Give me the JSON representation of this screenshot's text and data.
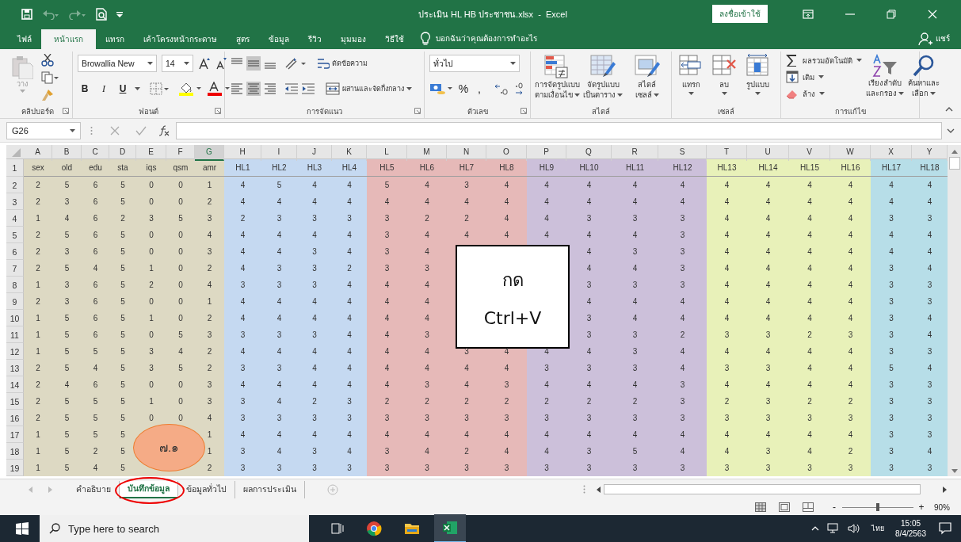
{
  "title_bar": {
    "title": "ประเมิน HL HB ประชาชน.xlsx  -  Excel",
    "sign_in": "ลงชื่อเข้าใช้"
  },
  "ribbon_tabs": [
    {
      "label": "ไฟล์",
      "selected": false
    },
    {
      "label": "หน้าแรก",
      "selected": true
    },
    {
      "label": "แทรก",
      "selected": false
    },
    {
      "label": "เค้าโครงหน้ากระดาษ",
      "selected": false
    },
    {
      "label": "สูตร",
      "selected": false
    },
    {
      "label": "ข้อมูล",
      "selected": false
    },
    {
      "label": "รีวิว",
      "selected": false
    },
    {
      "label": "มุมมอง",
      "selected": false
    },
    {
      "label": "วิธีใช้",
      "selected": false
    }
  ],
  "tell_me": "บอกฉันว่าคุณต้องการทำอะไร",
  "share": "แชร์",
  "ribbon": {
    "clipboard": {
      "paste": "วาง",
      "label": "คลิปบอร์ด"
    },
    "font": {
      "name": "Browallia New",
      "size": "14",
      "bold": "B",
      "italic": "I",
      "underline": "U",
      "label": "ฟอนต์"
    },
    "alignment": {
      "vertical": [
        {
          "selected": false
        },
        {
          "selected": true
        },
        {
          "selected": false
        }
      ],
      "horizontal": [
        {
          "selected": false
        },
        {
          "selected": true
        },
        {
          "selected": false
        }
      ],
      "wrap": "ตัดข้อความ",
      "merge": "ผสานและจัดกึ่งกลาง",
      "label": "การจัดแนว"
    },
    "number": {
      "format": "ทั่วไป",
      "percent": "%",
      "comma": ",",
      "label": "ตัวเลข"
    },
    "styles": {
      "buttons": [
        {
          "lines": [
            "การจัดรูปแบบ",
            "ตามเงื่อนไข"
          ]
        },
        {
          "lines": [
            "จัดรูปแบบ",
            "เป็นตาราง"
          ]
        },
        {
          "lines": [
            "สไตล์",
            "เซลล์"
          ]
        }
      ],
      "label": "สไตล์"
    },
    "cells": {
      "buttons": [
        "แทรก",
        "ลบ",
        "รูปแบบ"
      ],
      "label": "เซลล์"
    },
    "editing": {
      "small": [
        "ผลรวมอัตโนมัติ",
        "เติม",
        "ล้าง"
      ],
      "large": [
        {
          "lines": [
            "เรียงลำดับ",
            "และกรอง"
          ]
        },
        {
          "lines": [
            "ค้นหาและ",
            "เลือก"
          ]
        }
      ],
      "label": "การแก้ไข"
    }
  },
  "name_box": "G26",
  "grid": {
    "columns": [
      {
        "letter": "A",
        "selected": false,
        "color": "#ddd9c3"
      },
      {
        "letter": "B",
        "selected": false,
        "color": "#ddd9c3"
      },
      {
        "letter": "C",
        "selected": false,
        "color": "#ddd9c3"
      },
      {
        "letter": "D",
        "selected": false,
        "color": "#ddd9c3"
      },
      {
        "letter": "E",
        "selected": false,
        "color": "#ddd9c3"
      },
      {
        "letter": "F",
        "selected": false,
        "color": "#ddd9c3"
      },
      {
        "letter": "G",
        "selected": true,
        "color": "#ddd9c3"
      },
      {
        "letter": "H",
        "selected": false,
        "color": "#c5d9f1"
      },
      {
        "letter": "I",
        "selected": false,
        "color": "#c5d9f1"
      },
      {
        "letter": "J",
        "selected": false,
        "color": "#c5d9f1"
      },
      {
        "letter": "K",
        "selected": false,
        "color": "#c5d9f1"
      },
      {
        "letter": "L",
        "selected": false,
        "color": "#e6b9b8"
      },
      {
        "letter": "M",
        "selected": false,
        "color": "#e6b9b8"
      },
      {
        "letter": "N",
        "selected": false,
        "color": "#e6b9b8"
      },
      {
        "letter": "O",
        "selected": false,
        "color": "#e6b9b8"
      },
      {
        "letter": "P",
        "selected": false,
        "color": "#ccc0da"
      },
      {
        "letter": "Q",
        "selected": false,
        "color": "#ccc0da"
      },
      {
        "letter": "R",
        "selected": false,
        "color": "#ccc0da"
      },
      {
        "letter": "S",
        "selected": false,
        "color": "#ccc0da"
      },
      {
        "letter": "T",
        "selected": false,
        "color": "#e8f1b9"
      },
      {
        "letter": "U",
        "selected": false,
        "color": "#e8f1b9"
      },
      {
        "letter": "V",
        "selected": false,
        "color": "#e8f1b9"
      },
      {
        "letter": "W",
        "selected": false,
        "color": "#e8f1b9"
      },
      {
        "letter": "X",
        "selected": false,
        "color": "#b7dee8"
      },
      {
        "letter": "Y",
        "selected": false,
        "color": "#b7dee8"
      }
    ],
    "rows": [
      {
        "number": "1",
        "kind": "header",
        "cells": [
          "sex",
          "old",
          "edu",
          "sta",
          "iqs",
          "qsm",
          "amr",
          "HL1",
          "HL2",
          "HL3",
          "HL4",
          "HL5",
          "HL6",
          "HL7",
          "HL8",
          "HL9",
          "HL10",
          "HL11",
          "HL12",
          "HL13",
          "HL14",
          "HL15",
          "HL16",
          "HL17",
          "HL18"
        ]
      },
      {
        "number": "2",
        "kind": "data",
        "cells": [
          "2",
          "5",
          "6",
          "5",
          "0",
          "0",
          "1",
          "4",
          "5",
          "4",
          "4",
          "5",
          "4",
          "3",
          "4",
          "4",
          "4",
          "4",
          "4",
          "4",
          "4",
          "4",
          "4",
          "4",
          "4"
        ]
      },
      {
        "number": "3",
        "kind": "data",
        "cells": [
          "2",
          "3",
          "6",
          "5",
          "0",
          "0",
          "2",
          "4",
          "4",
          "4",
          "4",
          "4",
          "4",
          "4",
          "4",
          "4",
          "4",
          "4",
          "4",
          "4",
          "4",
          "4",
          "4",
          "4",
          "4"
        ]
      },
      {
        "number": "4",
        "kind": "data",
        "cells": [
          "1",
          "4",
          "6",
          "2",
          "3",
          "5",
          "3",
          "2",
          "3",
          "3",
          "3",
          "3",
          "2",
          "2",
          "4",
          "4",
          "3",
          "3",
          "3",
          "4",
          "4",
          "4",
          "4",
          "3",
          "3"
        ]
      },
      {
        "number": "5",
        "kind": "data",
        "cells": [
          "2",
          "5",
          "6",
          "5",
          "0",
          "0",
          "4",
          "4",
          "4",
          "4",
          "4",
          "3",
          "4",
          "4",
          "4",
          "4",
          "4",
          "4",
          "3",
          "4",
          "4",
          "4",
          "4",
          "4",
          "4"
        ]
      },
      {
        "number": "6",
        "kind": "data",
        "cells": [
          "2",
          "3",
          "6",
          "5",
          "0",
          "0",
          "3",
          "4",
          "4",
          "3",
          "4",
          "3",
          "4",
          null,
          null,
          null,
          "4",
          "3",
          "3",
          "4",
          "4",
          "4",
          "4",
          "4",
          "4"
        ]
      },
      {
        "number": "7",
        "kind": "data",
        "cells": [
          "2",
          "5",
          "4",
          "5",
          "1",
          "0",
          "2",
          "4",
          "3",
          "3",
          "2",
          "3",
          "3",
          null,
          null,
          null,
          "4",
          "4",
          "3",
          "4",
          "4",
          "4",
          "4",
          "3",
          "4"
        ]
      },
      {
        "number": "8",
        "kind": "data",
        "cells": [
          "1",
          "3",
          "6",
          "5",
          "2",
          "0",
          "4",
          "3",
          "3",
          "3",
          "4",
          "4",
          "4",
          null,
          null,
          null,
          "3",
          "3",
          "3",
          "4",
          "4",
          "4",
          "4",
          "3",
          "3"
        ]
      },
      {
        "number": "9",
        "kind": "data",
        "cells": [
          "2",
          "3",
          "6",
          "5",
          "0",
          "0",
          "1",
          "4",
          "4",
          "4",
          "4",
          "4",
          "4",
          null,
          null,
          null,
          "4",
          "4",
          "4",
          "4",
          "4",
          "4",
          "4",
          "3",
          "3"
        ]
      },
      {
        "number": "10",
        "kind": "data",
        "cells": [
          "1",
          "5",
          "6",
          "5",
          "1",
          "0",
          "2",
          "4",
          "4",
          "4",
          "4",
          "4",
          "4",
          null,
          null,
          null,
          "3",
          "4",
          "4",
          "4",
          "4",
          "4",
          "4",
          "3",
          "4"
        ]
      },
      {
        "number": "11",
        "kind": "data",
        "cells": [
          "1",
          "5",
          "6",
          "5",
          "0",
          "5",
          "3",
          "3",
          "3",
          "3",
          "4",
          "4",
          "3",
          null,
          null,
          null,
          "3",
          "3",
          "2",
          "3",
          "3",
          "2",
          "3",
          "3",
          "4"
        ]
      },
      {
        "number": "12",
        "kind": "data",
        "cells": [
          "1",
          "5",
          "5",
          "5",
          "3",
          "4",
          "2",
          "4",
          "4",
          "4",
          "4",
          "4",
          "4",
          "3",
          "4",
          "4",
          "4",
          "3",
          "4",
          "4",
          "4",
          "4",
          "4",
          "3",
          "3"
        ]
      },
      {
        "number": "13",
        "kind": "data",
        "cells": [
          "2",
          "5",
          "4",
          "5",
          "3",
          "5",
          "2",
          "3",
          "3",
          "4",
          "4",
          "4",
          "4",
          "4",
          "4",
          "3",
          "3",
          "3",
          "4",
          "3",
          "3",
          "4",
          "4",
          "5",
          "4"
        ]
      },
      {
        "number": "14",
        "kind": "data",
        "cells": [
          "2",
          "4",
          "6",
          "5",
          "0",
          "0",
          "3",
          "4",
          "4",
          "4",
          "4",
          "4",
          "3",
          "4",
          "3",
          "4",
          "4",
          "4",
          "3",
          "4",
          "4",
          "4",
          "4",
          "3",
          "3"
        ]
      },
      {
        "number": "15",
        "kind": "data",
        "cells": [
          "2",
          "5",
          "5",
          "5",
          "1",
          "0",
          "3",
          "3",
          "4",
          "2",
          "3",
          "2",
          "2",
          "2",
          "2",
          "2",
          "2",
          "2",
          "3",
          "2",
          "3",
          "2",
          "2",
          "3",
          "3"
        ]
      },
      {
        "number": "16",
        "kind": "data",
        "cells": [
          "2",
          "5",
          "5",
          "5",
          "0",
          "0",
          "4",
          "3",
          "3",
          "3",
          "3",
          "3",
          "3",
          "3",
          "3",
          "3",
          "3",
          "3",
          "3",
          "3",
          "3",
          "3",
          "3",
          "3",
          "3"
        ]
      },
      {
        "number": "17",
        "kind": "data",
        "cells": [
          "1",
          "5",
          "5",
          "5",
          null,
          null,
          "1",
          "4",
          "4",
          "4",
          "4",
          "4",
          "4",
          "4",
          "4",
          "4",
          "4",
          "4",
          "4",
          "4",
          "4",
          "4",
          "4",
          "3",
          "3"
        ]
      },
      {
        "number": "18",
        "kind": "data",
        "cells": [
          "1",
          "5",
          "2",
          "5",
          null,
          null,
          "1",
          "3",
          "4",
          "3",
          "4",
          "3",
          "4",
          "2",
          "4",
          "4",
          "3",
          "5",
          "4",
          "4",
          "3",
          "4",
          "2",
          "3",
          "4"
        ]
      },
      {
        "number": "19",
        "kind": "data",
        "cells": [
          "1",
          "5",
          "4",
          "5",
          null,
          null,
          "2",
          "3",
          "3",
          "3",
          "3",
          "3",
          "3",
          "3",
          "3",
          "3",
          "3",
          "3",
          "3",
          "3",
          "3",
          "3",
          "3",
          "3",
          "3"
        ]
      }
    ]
  },
  "callout": {
    "lines": [
      "กด",
      "Ctrl+V"
    ]
  },
  "badge": "๗.๑",
  "sheet_tabs": [
    {
      "label": "คำอธิบาย",
      "selected": false,
      "circled": false
    },
    {
      "label": "บันทึกข้อมูล",
      "selected": true,
      "circled": true
    },
    {
      "label": "ข้อมูลทั่วไป",
      "selected": false,
      "circled": false
    },
    {
      "label": "ผลการประเมิน",
      "selected": false,
      "circled": false
    }
  ],
  "status_bar": {
    "zoom": {
      "level": 0.5,
      "minus": "-",
      "plus": "+",
      "percent": "90%"
    }
  },
  "taskbar": {
    "search_placeholder": "Type here to search",
    "language": "ไทย",
    "time": "15:05",
    "date": "8/4/2563"
  }
}
